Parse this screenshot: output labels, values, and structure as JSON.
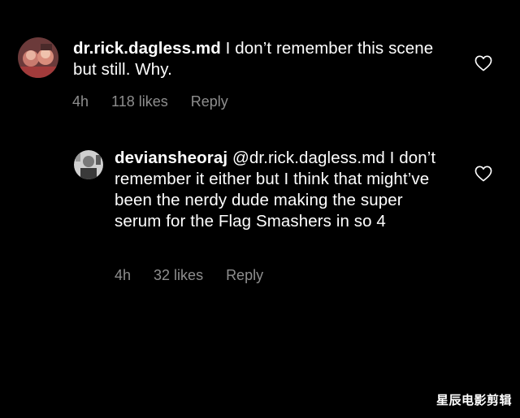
{
  "comments": [
    {
      "username": "dr.rick.dagless.md",
      "text": " I don’t remember this scene but still. Why.",
      "time": "4h",
      "likes": "118 likes",
      "reply": "Reply"
    },
    {
      "username": "deviansheoraj",
      "text": " @dr.rick.dagless.md I don’t remember it either but I think that might’ve been the nerdy dude making the super serum for the Flag Smashers in so 4",
      "time": "4h",
      "likes": "32 likes",
      "reply": "Reply"
    }
  ],
  "watermark": "星辰电影剪辑",
  "colors": {
    "background": "#000000",
    "text": "#ffffff",
    "meta": "#8e8e8e"
  },
  "icons": {
    "like": "heart-outline-icon"
  }
}
